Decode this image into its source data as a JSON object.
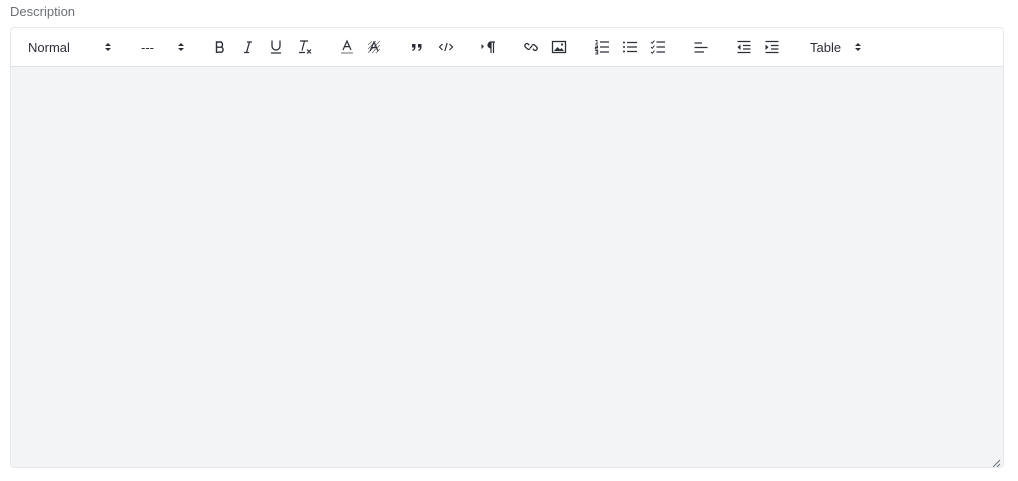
{
  "field": {
    "label": "Description"
  },
  "toolbar": {
    "header_picker": {
      "selected": "Normal",
      "icon": "up-down-caret-icon"
    },
    "size_picker": {
      "selected": "---",
      "icon": "up-down-caret-icon"
    },
    "table_picker": {
      "selected": "Table",
      "icon": "up-down-caret-icon"
    },
    "buttons": [
      {
        "name": "bold",
        "icon": "bold-icon"
      },
      {
        "name": "italic",
        "icon": "italic-icon"
      },
      {
        "name": "underline",
        "icon": "underline-icon"
      },
      {
        "name": "clear-formatting",
        "icon": "clear-format-icon"
      },
      {
        "name": "text-color",
        "icon": "text-color-icon"
      },
      {
        "name": "background-color",
        "icon": "highlight-icon"
      },
      {
        "name": "blockquote",
        "icon": "quote-icon"
      },
      {
        "name": "code",
        "icon": "code-icon"
      },
      {
        "name": "text-direction",
        "icon": "paragraph-direction-icon"
      },
      {
        "name": "link",
        "icon": "link-icon"
      },
      {
        "name": "image",
        "icon": "image-icon"
      },
      {
        "name": "ordered-list",
        "icon": "ordered-list-icon"
      },
      {
        "name": "bullet-list",
        "icon": "bullet-list-icon"
      },
      {
        "name": "check-list",
        "icon": "check-list-icon"
      },
      {
        "name": "align",
        "icon": "align-left-icon"
      },
      {
        "name": "outdent",
        "icon": "outdent-icon"
      },
      {
        "name": "indent",
        "icon": "indent-icon"
      }
    ]
  },
  "editor": {
    "content": "",
    "background": "#f3f4f6"
  }
}
